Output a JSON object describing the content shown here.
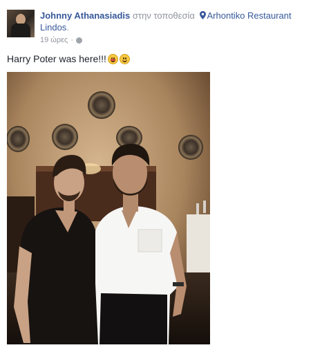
{
  "post": {
    "author": "Johnny Athanasiadis",
    "location_connector": "στην τοποθεσία",
    "location": "Arhontiko Restaurant Lindos",
    "location_suffix": ".",
    "timestamp": "19 ώρες",
    "separator": "·",
    "privacy_icon": "globe-icon",
    "location_icon": "map-pin-icon",
    "text": "Harry Poter was here!!!",
    "emojis": [
      "tongue-out-emoji",
      "smiling-face-emoji"
    ]
  },
  "colors": {
    "link": "#365899",
    "secondary_text": "#90949c",
    "body_text": "#1d2129"
  }
}
